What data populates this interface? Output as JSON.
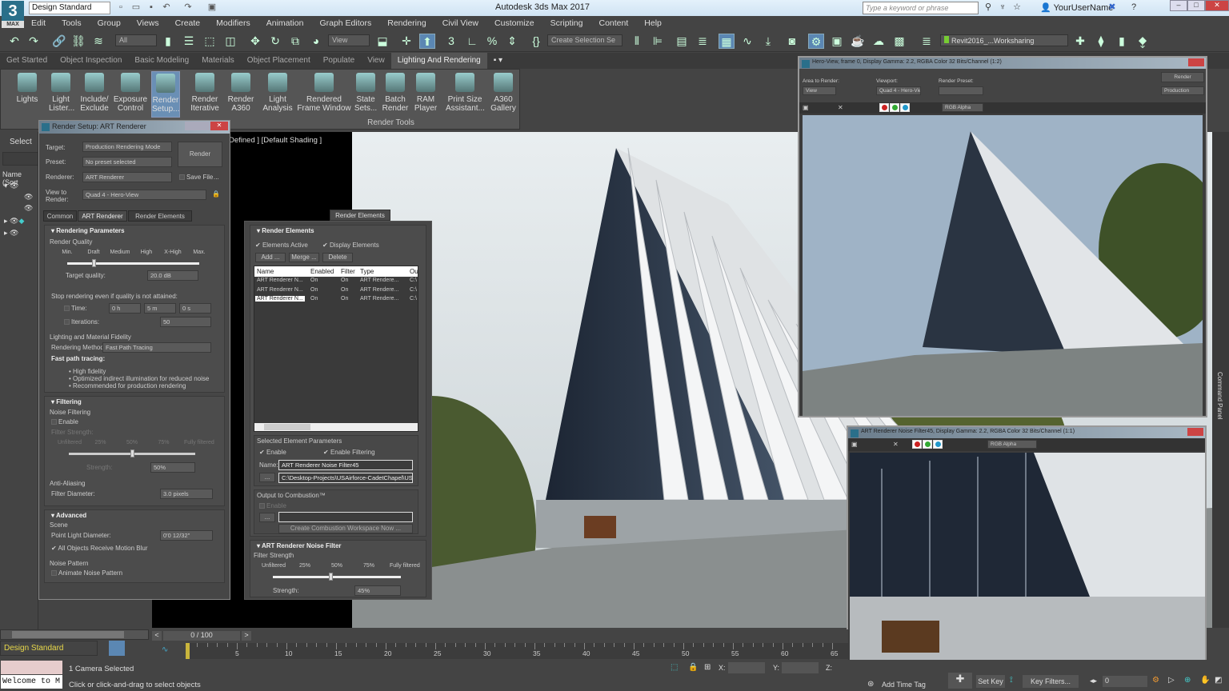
{
  "app": {
    "title": "Autodesk 3ds Max 2017",
    "logo": "3",
    "logo_sub": "MAX",
    "workspace": "Design Standard",
    "search_placeholder": "Type a keyword or phrase",
    "user": "YourUserName"
  },
  "menu": [
    "Edit",
    "Tools",
    "Group",
    "Views",
    "Create",
    "Modifiers",
    "Animation",
    "Graph Editors",
    "Rendering",
    "Civil View",
    "Customize",
    "Scripting",
    "Content",
    "Help"
  ],
  "toolbar": {
    "filter": "All",
    "ref_coord": "View",
    "selection_set": "Create Selection Se",
    "layer": "Revit2016_...Worksharing"
  },
  "ribbon": {
    "tabs": [
      "Get Started",
      "Object Inspection",
      "Basic Modeling",
      "Materials",
      "Object Placement",
      "Populate",
      "View",
      "Lighting And Rendering"
    ],
    "active_tab": "Lighting And Rendering",
    "buttons": [
      {
        "label": "Lights"
      },
      {
        "label": "Light Lister..."
      },
      {
        "label": "Include/ Exclude"
      },
      {
        "label": "Exposure Control"
      },
      {
        "label": "Render Setup..."
      },
      {
        "label": "Render Iterative"
      },
      {
        "label": "Render A360"
      },
      {
        "label": "Light Analysis"
      },
      {
        "label": "Rendered Frame Window"
      },
      {
        "label": "State Sets..."
      },
      {
        "label": "Batch Render"
      },
      {
        "label": "RAM Player"
      },
      {
        "label": "Print Size Assistant..."
      },
      {
        "label": "A360 Gallery"
      }
    ],
    "group_label": "Render Tools"
  },
  "explorer": {
    "select": "Select",
    "name_header": "Name (Sort"
  },
  "viewport": {
    "label": "Defined ] [Default Shading ]"
  },
  "render_setup": {
    "title": "Render Setup: ART Renderer",
    "target_label": "Target:",
    "target": "Production Rendering Mode",
    "preset_label": "Preset:",
    "preset": "No preset selected",
    "renderer_label": "Renderer:",
    "renderer": "ART Renderer",
    "save_file": "Save File",
    "more": "...",
    "view_label": "View to Render:",
    "view": "Quad 4 - Hero-View",
    "render_button": "Render",
    "tabs": [
      "Common",
      "ART Renderer",
      "Render Elements"
    ],
    "rendering_parameters": "Rendering Parameters",
    "render_quality": "Render Quality",
    "quality_ticks": [
      "Min.",
      "Draft",
      "Medium",
      "High",
      "X-High",
      "Max."
    ],
    "quality_slider_fraction": 0.2,
    "target_quality_label": "Target quality:",
    "target_quality": "20.0 dB",
    "stop_label": "Stop rendering even if quality is not attained:",
    "time_label": "Time:",
    "time_h": "0 h",
    "time_m": "5 m",
    "time_s": "0 s",
    "iterations_label": "Iterations:",
    "iterations": "50",
    "fidelity_label": "Lighting and Material Fidelity",
    "method_label": "Rendering Method:",
    "method": "Fast Path Tracing",
    "fast_path_title": "Fast path tracing:",
    "fast_path_bullets": [
      "High fidelity",
      "Optimized indirect illumination for reduced noise",
      "Recommended for production rendering"
    ],
    "filtering": "Filtering",
    "noise_filtering": "Noise Filtering",
    "enable": "Enable",
    "filter_strength": "Filter Strength:",
    "filter_ticks": [
      "Unfiltered",
      "25%",
      "50%",
      "75%",
      "Fully filtered"
    ],
    "filter_slider_fraction": 0.5,
    "strength_label": "Strength:",
    "strength": "50%",
    "anti_aliasing": "Anti-Aliasing",
    "filter_diameter_label": "Filter Diameter:",
    "filter_diameter": "3.0 pixels",
    "advanced": "Advanced",
    "scene": "Scene",
    "point_light_label": "Point Light Diameter:",
    "point_light": "0'0 12/32\"",
    "motion_blur": "All Objects Receive Motion Blur",
    "noise_pattern": "Noise Pattern",
    "animate_noise": "Animate Noise Pattern"
  },
  "render_elements": {
    "tab": "Render Elements",
    "title": "Render Elements",
    "elements_active": "Elements Active",
    "display_elements": "Display Elements",
    "add": "Add ...",
    "merge": "Merge ...",
    "delete": "Delete",
    "columns": [
      "Name",
      "Enabled",
      "Filter",
      "Type",
      "Ou"
    ],
    "rows": [
      [
        "ART Renderer N...",
        "On",
        "On",
        "ART Rendere...",
        "C:\\"
      ],
      [
        "ART Renderer N...",
        "On",
        "On",
        "ART Rendere...",
        "C:\\"
      ],
      [
        "ART Renderer N...",
        "On",
        "On",
        "ART Rendere...",
        "C:\\"
      ]
    ],
    "selected_params": "Selected Element Parameters",
    "enable": "Enable",
    "enable_filtering": "Enable Filtering",
    "name_label": "Name:",
    "name": "ART Renderer Noise Filter45",
    "browse": "...",
    "path": "C:\\Desktop-Projects\\USAirforce-CadetChapel\\USA",
    "combustion": "Output to Combustion™",
    "combustion_enable": "Enable",
    "create_workspace": "Create Combustion Workspace Now ...",
    "noise_filter_title": "ART Renderer Noise Filter",
    "filter_strength": "Filter Strength",
    "filter_ticks": [
      "Unfiltered",
      "25%",
      "50%",
      "75%",
      "Fully filtered"
    ],
    "slider_fraction": 0.45,
    "strength_label": "Strength:",
    "strength": "45%"
  },
  "frame_window_1": {
    "title": "Hero-View, frame 0, Display Gamma: 2.2, RGBA Color 32 Bits/Channel (1:2)",
    "area_label": "Area to Render:",
    "area": "View",
    "viewport_label": "Viewport:",
    "viewport": "Quad 4 - Hero-Vie",
    "preset_label": "Render Preset:",
    "preset": "",
    "render": "Render",
    "mode": "Production",
    "channel": "RGB Alpha"
  },
  "frame_window_2": {
    "title": "ART Renderer Noise Filter45, Display Gamma: 2.2, RGBA Color 32 Bits/Channel (1:1)",
    "channel": "RGB Alpha"
  },
  "command_panel": "Command Panel",
  "timeline": {
    "frame": "0 / 100",
    "ticks": [
      "0",
      "5",
      "10",
      "15",
      "20",
      "25",
      "30",
      "35",
      "40",
      "45",
      "50",
      "55",
      "60",
      "65"
    ],
    "workspace": "Design Standard"
  },
  "status": {
    "selected": "1 Camera Selected",
    "prompt": "Click or click-and-drag to select objects",
    "listener": "Welcome to M",
    "x_label": "X:",
    "y_label": "Y:",
    "z_label": "Z:",
    "add_time_tag": "Add Time Tag",
    "set_key": "Set Key",
    "key_filters": "Key Filters...",
    "frame_field": "0"
  },
  "colors": {
    "accent": "#5b87b3",
    "bg": "#444444",
    "title_bar": "#dbeaf5",
    "workspace_text": "#e8d84a"
  }
}
